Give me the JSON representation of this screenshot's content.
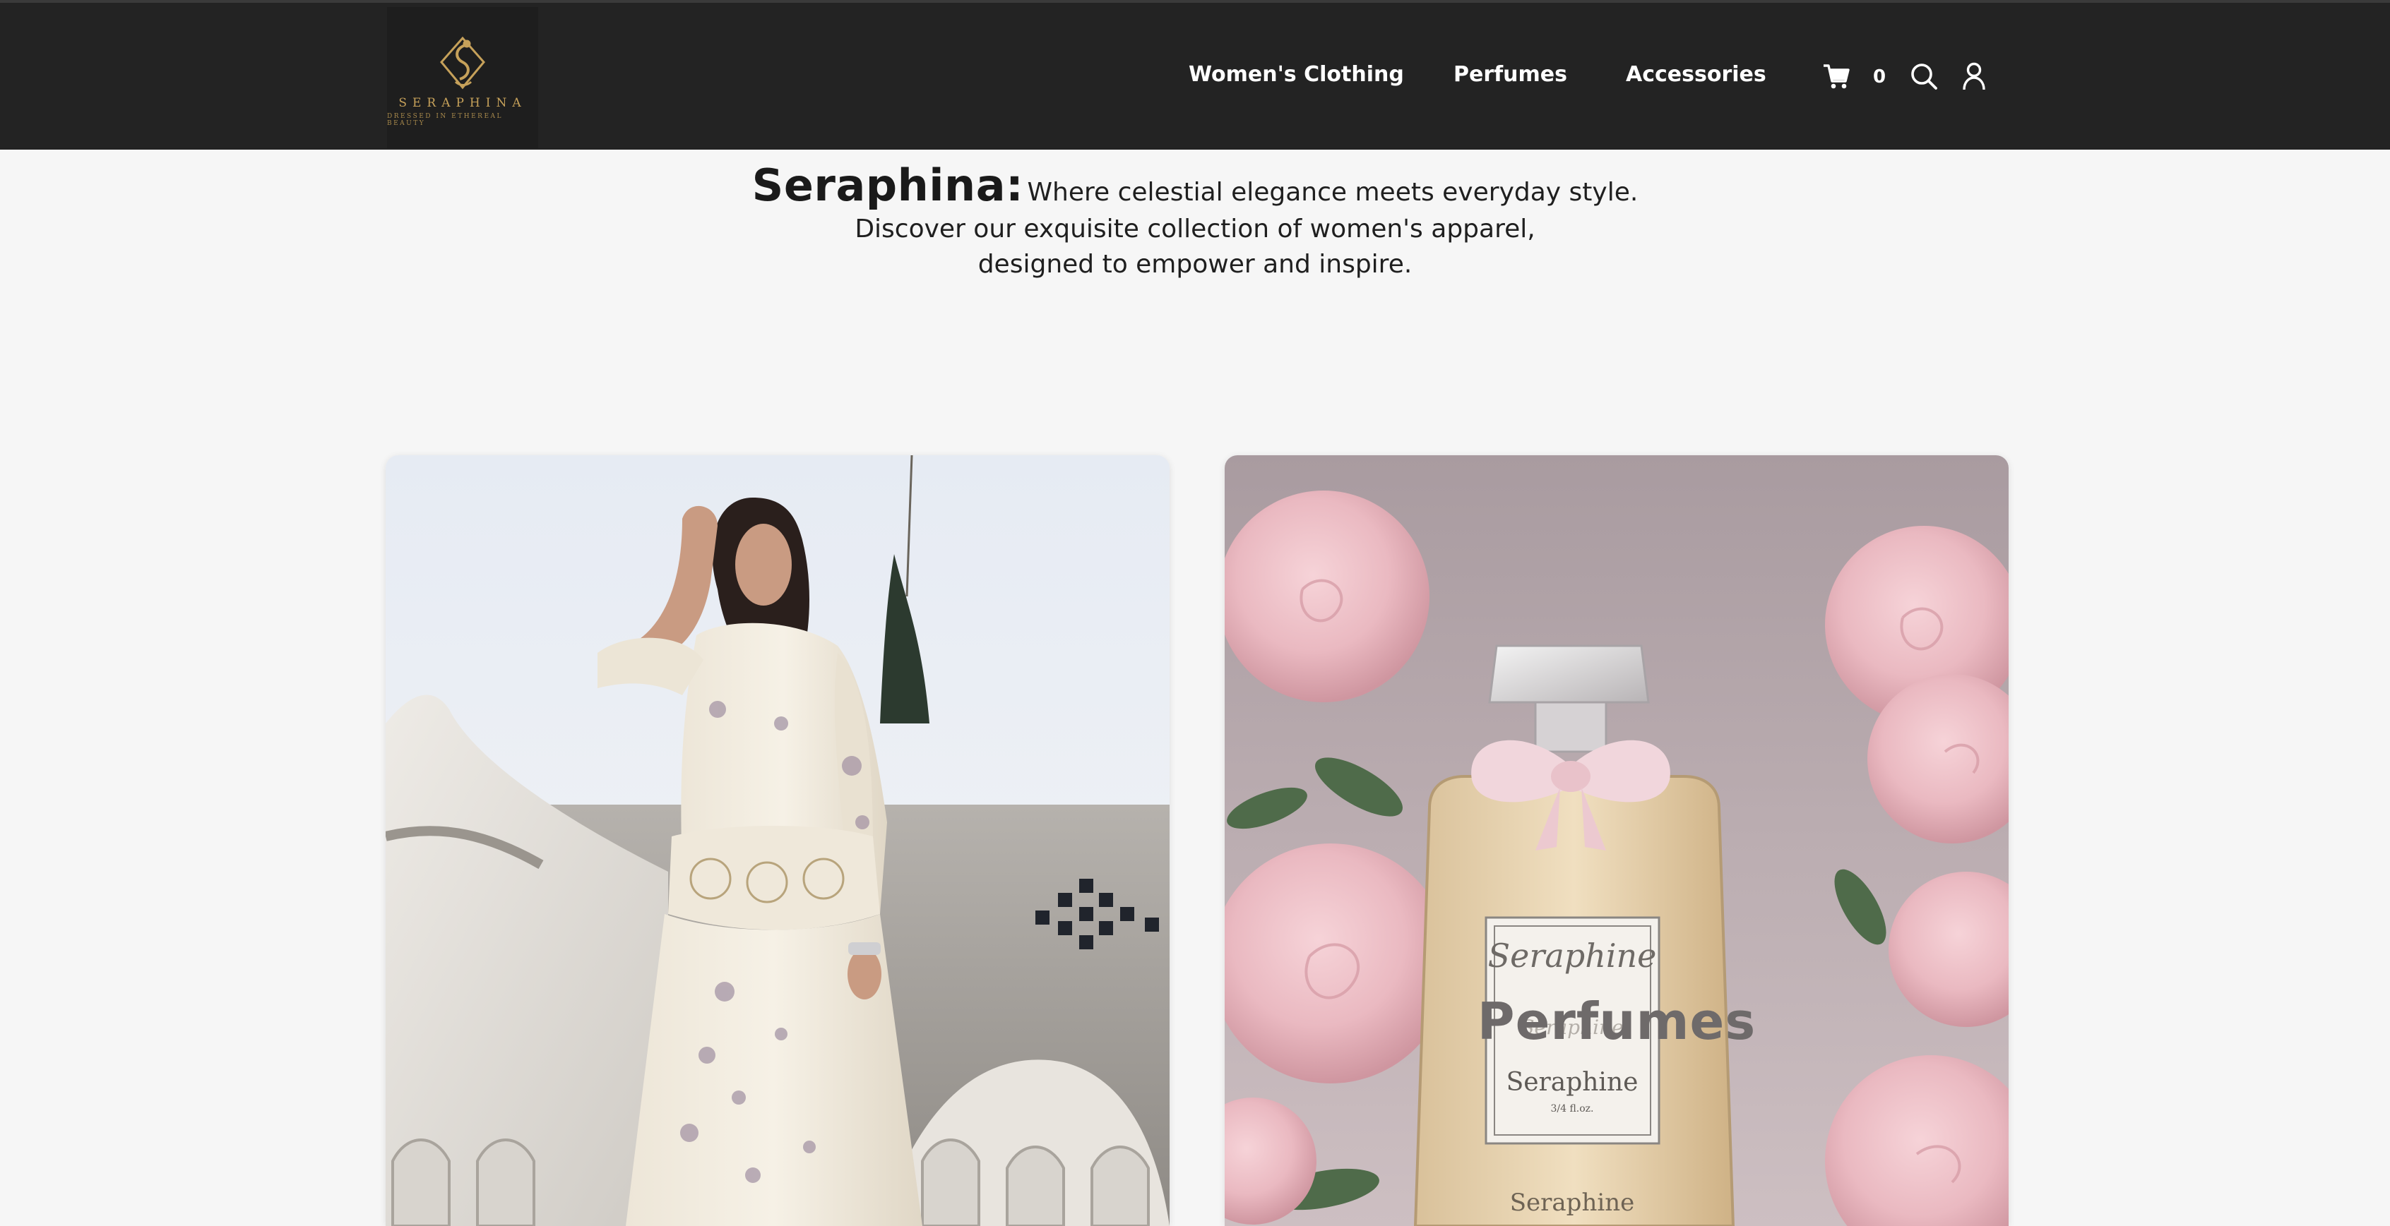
{
  "header": {
    "logo": {
      "name": "SERAPHINA",
      "tagline": "DRESSED IN ETHEREAL BEAUTY",
      "icon": "swan-monogram-logo"
    },
    "nav": [
      {
        "label": "Women's Clothing"
      },
      {
        "label": "Perfumes"
      },
      {
        "label": "Accessories"
      }
    ],
    "cart": {
      "icon": "cart-icon",
      "count": "0"
    },
    "search": {
      "icon": "search-icon"
    },
    "account": {
      "icon": "user-icon"
    }
  },
  "hero": {
    "brand": "Seraphina:",
    "tagline": "Where celestial elegance meets everyday style.",
    "line2": "Discover our exquisite collection of women's apparel,",
    "line3": "designed to empower and inspire."
  },
  "categories": [
    {
      "label": "",
      "image": "woman-in-embroidered-cream-dress-photo"
    },
    {
      "label": "Perfumes",
      "image": "perfume-bottle-with-roses-photo",
      "bottle_text": {
        "script": "Seraphine",
        "engraved": "Seraphine",
        "volume": "3/4 fl.oz.",
        "base": "Seraphine"
      }
    }
  ],
  "colors": {
    "header_bg": "#232323",
    "page_bg": "#f6f6f6",
    "logo_gold": "#c6a15a",
    "nav_text": "#ffffff"
  }
}
